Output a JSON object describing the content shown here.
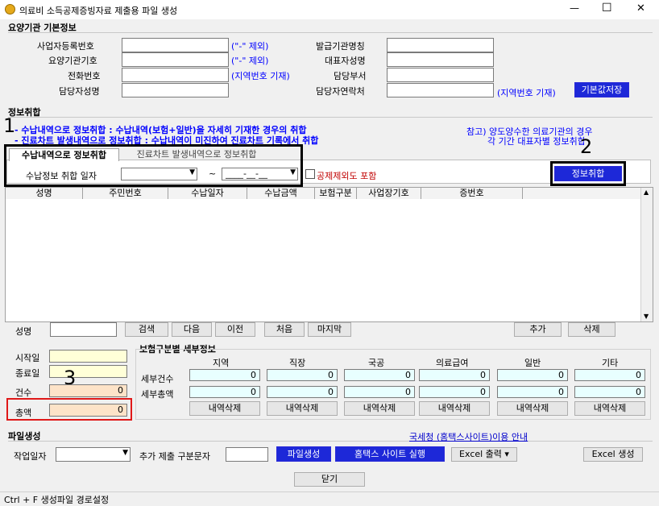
{
  "window": {
    "title": "의료비 소득공제증빙자료 제출용 파일 생성",
    "min": "—",
    "max": "☐",
    "close": "✕"
  },
  "basic": {
    "section_title": "요양기관 기본정보",
    "biz_reg_label": "사업자등록번호",
    "biz_reg_note": "(\"-\" 제외)",
    "inst_code_label": "요양기관기호",
    "inst_code_note": "(\"-\" 제외)",
    "phone_label": "전화번호",
    "phone_note": "(지역번호 기재)",
    "manager_label": "담당자성명",
    "issuer_label": "발급기관명칭",
    "rep_label": "대표자성명",
    "dept_label": "담당부서",
    "contact_label": "담당자연락처",
    "contact_note": "(지역번호 기재)",
    "save_default": "기본값저장"
  },
  "collect": {
    "section_title": "정보취합",
    "line1": "- 수납내역으로 정보취합 : 수납내역(보험+일반)을 자세히 기재한 경우의 취합",
    "line2": "- 진료차트 발생내역으로 정보취합 : 수납내역이 미진하여 진료차트 기록에서 취합",
    "note1": "참고) 양도양수한 의료기관의 경우",
    "note2": "각 기간 대표자별 정보취합",
    "tab1": "수납내역으로 정보취합",
    "tab2": "진료차트 발생내역으로 정보취합",
    "date_label": "수납정보 취합 일자",
    "tilde": "~",
    "date_to": "____-__-__",
    "include_label": "공제제외도 포함",
    "collect_btn": "정보취합"
  },
  "table": {
    "columns": [
      "성명",
      "주민번호",
      "수납일자",
      "수납금액",
      "보험구분",
      "사업장기호",
      "증번호"
    ]
  },
  "search": {
    "name_label": "성명",
    "search": "검색",
    "next": "다음",
    "prev": "이전",
    "first": "처음",
    "last": "마지막",
    "add": "추가",
    "delete": "삭제"
  },
  "summary": {
    "start_label": "시작일",
    "end_label": "종료일",
    "count_label": "건수",
    "count": "0",
    "total_label": "총액",
    "total": "0"
  },
  "detail": {
    "title": "보험구분별 세부정보",
    "cols": [
      "지역",
      "직장",
      "국공",
      "의료급여",
      "일반",
      "기타"
    ],
    "count_label": "세부건수",
    "amount_label": "세부총액",
    "counts": [
      "0",
      "0",
      "0",
      "0",
      "0",
      "0"
    ],
    "amounts": [
      "0",
      "0",
      "0",
      "0",
      "0",
      "0"
    ],
    "del_label": "내역삭제"
  },
  "file": {
    "section_title": "파일생성",
    "hometax_link": "국세청 (홈택스사이트)이용 안내",
    "work_date_label": "작업일자",
    "extra_label": "추가 제출 구분문자",
    "create_btn": "파일생성",
    "hometax_btn": "홈택스 사이트 실행",
    "excel_out": "Excel 출력 ▾",
    "excel_make": "Excel 생성",
    "close_btn": "닫기"
  },
  "status": {
    "text": "Ctrl + F 생성파일 경로설정"
  },
  "marks": {
    "m1": "1",
    "m2": "2",
    "m3": "3"
  }
}
